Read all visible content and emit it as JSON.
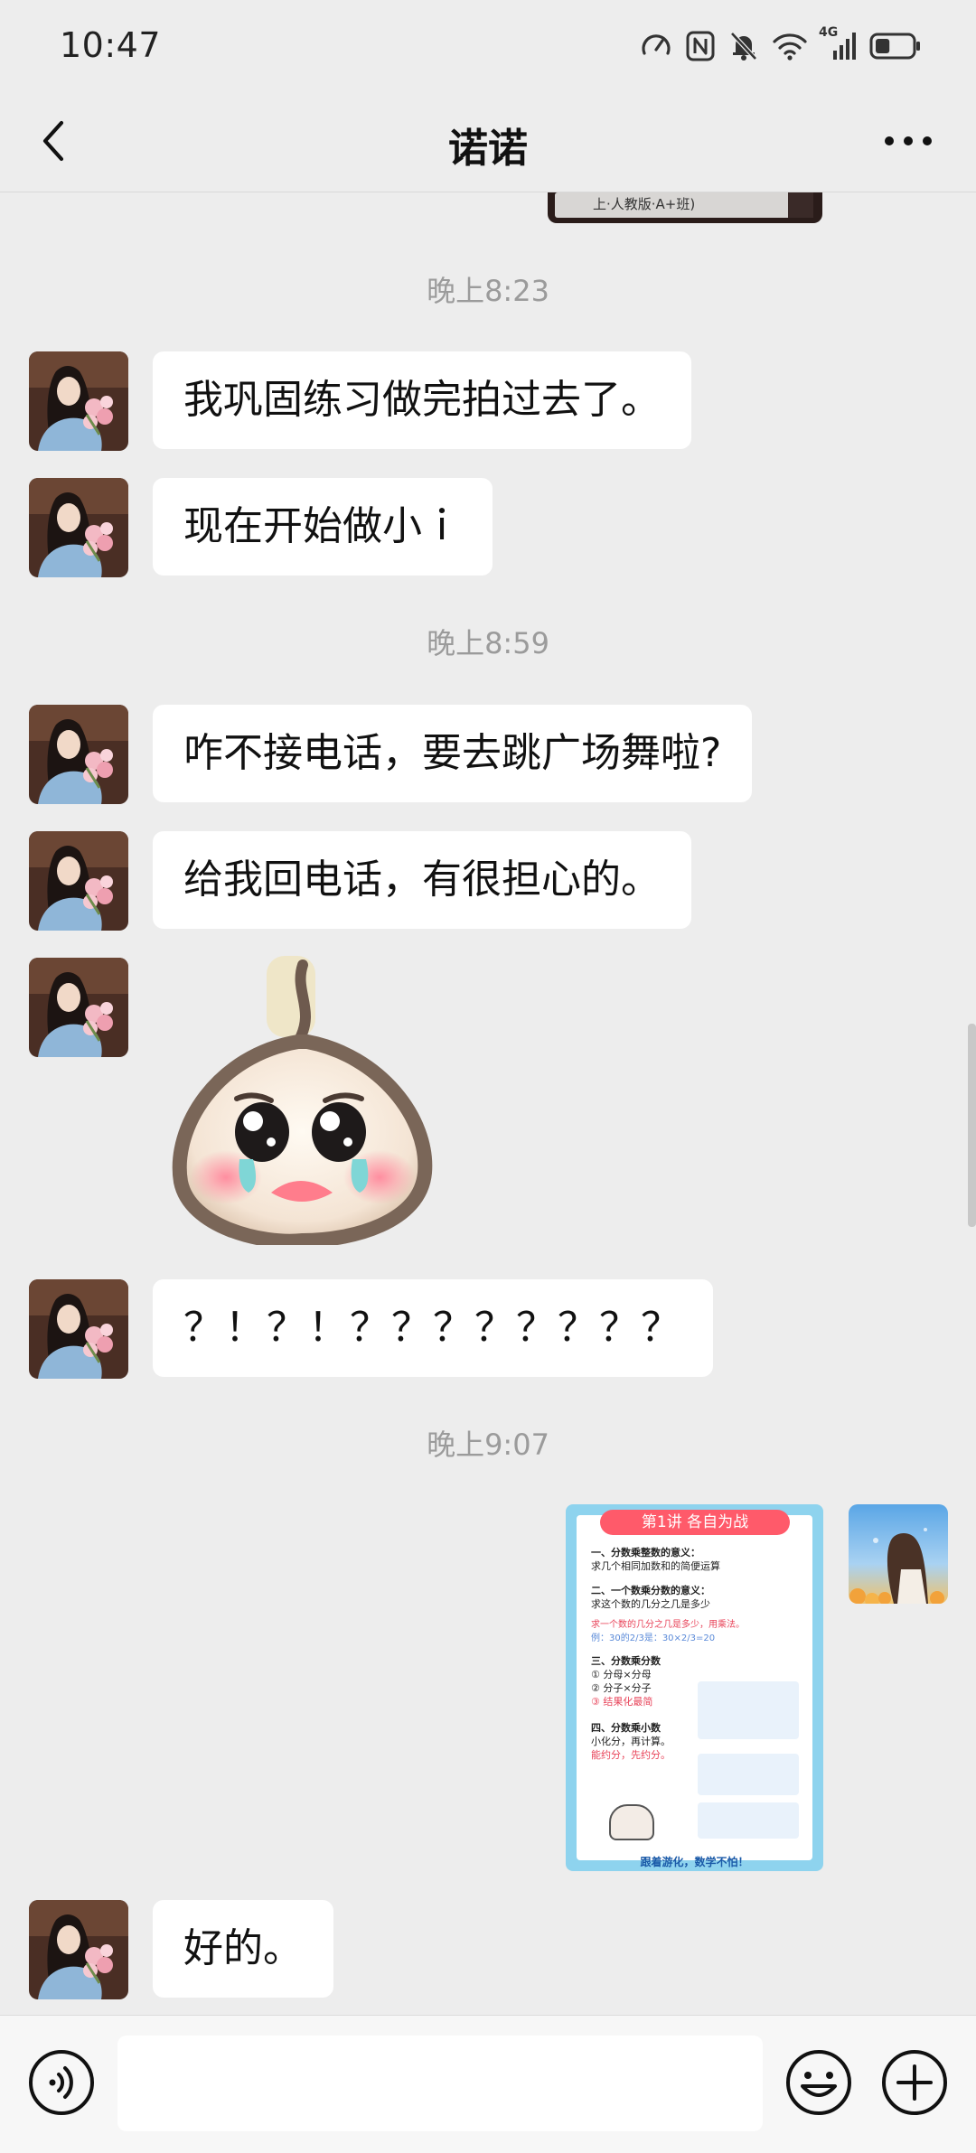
{
  "status_bar": {
    "time": "10:47",
    "network_label": "4G",
    "icons": [
      "speed-gauge-icon",
      "nfc-icon",
      "mute-bell-icon",
      "wifi-icon",
      "signal-icon",
      "battery-icon"
    ],
    "battery_level": 0.4
  },
  "header": {
    "title": "诺诺",
    "back_icon": "chevron-left-icon",
    "more_icon": "more-dots-icon"
  },
  "chat": {
    "top_image_caption": "上·人教版·A+班)",
    "messages": [
      {
        "type": "time",
        "text": "晚上8:23"
      },
      {
        "type": "text",
        "from": "contact",
        "text": "我巩固练习做完拍过去了。"
      },
      {
        "type": "text",
        "from": "contact",
        "text": "现在开始做小ｉ"
      },
      {
        "type": "time",
        "text": "晚上8:59"
      },
      {
        "type": "text",
        "from": "contact",
        "text": "咋不接电话，要去跳广场舞啦?"
      },
      {
        "type": "text",
        "from": "contact",
        "text": "给我回电话，有很担心的。"
      },
      {
        "type": "sticker",
        "from": "contact",
        "sticker": "crying-bun-sticker"
      },
      {
        "type": "text",
        "from": "contact",
        "text": "？！？！？？？？？？？？"
      },
      {
        "type": "time",
        "text": "晚上9:07"
      },
      {
        "type": "image",
        "from": "me"
      },
      {
        "type": "text",
        "from": "contact",
        "text": "好的。"
      }
    ],
    "worksheet": {
      "title": "第1讲 各自为战",
      "sec1_title": "一、分数乘整数的意义：",
      "sec1_body": "求几个相同加数和的简便运算",
      "sec2_title": "二、一个数乘分数的意义：",
      "sec2_body": "求这个数的几分之几是多少",
      "sec2_rule": "求一个数的几分之几是多少，用乘法。",
      "sec2_example": "例：30的2/3是：30×2/3=20",
      "sec3_title": "三、分数乘分数",
      "sec3_line1": "① 分母×分母",
      "sec3_line2": "② 分子×分子",
      "sec3_line3": "③ 结果化最简",
      "sec4_title": "四、分数乘小数",
      "sec4_line1": "小化分，再计算。",
      "sec4_line2": "能约分，先约分。",
      "footer": "跟着游化，数学不怕！"
    }
  },
  "input_bar": {
    "voice_icon": "voice-icon",
    "emoji_icon": "emoji-icon",
    "plus_icon": "plus-icon",
    "input_value": ""
  }
}
